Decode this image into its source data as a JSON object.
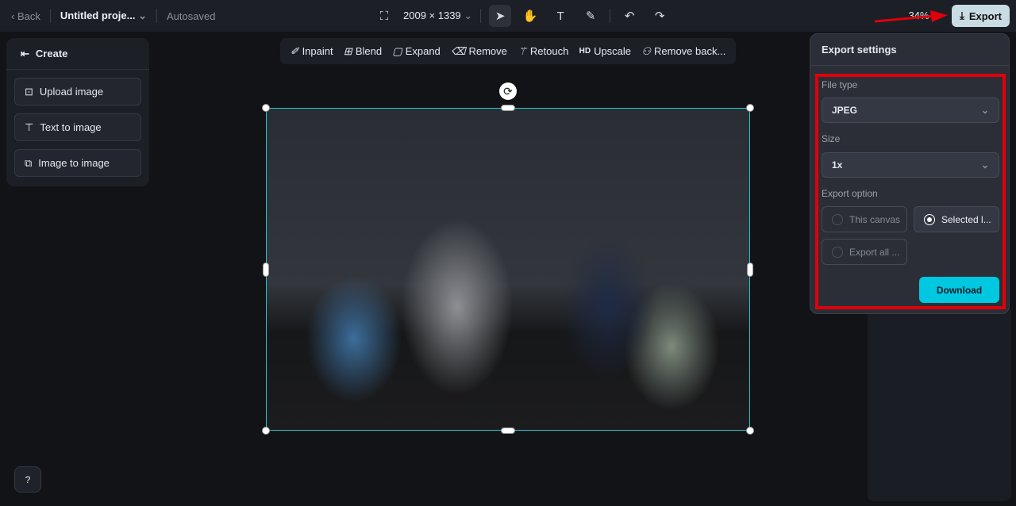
{
  "topbar": {
    "back": "Back",
    "project": "Untitled proje...",
    "status": "Autosaved",
    "dimensions": "2009 × 1339",
    "zoom": "34%",
    "export": "Export"
  },
  "left_panel": {
    "title": "Create",
    "buttons": [
      "Upload image",
      "Text to image",
      "Image to image"
    ]
  },
  "edit_tools": [
    "Inpaint",
    "Blend",
    "Expand",
    "Remove",
    "Retouch",
    "Upscale",
    "Remove back..."
  ],
  "upscale_badge": "HD",
  "export_settings": {
    "title": "Export settings",
    "file_type_label": "File type",
    "file_type": "JPEG",
    "size_label": "Size",
    "size": "1x",
    "option_label": "Export option",
    "options": [
      "This canvas",
      "Selected l...",
      "Export all ..."
    ],
    "selected_option": "Selected l...",
    "download": "Download"
  },
  "colors": {
    "accent": "#00c8e0",
    "selection": "#1fc8cf",
    "annotation": "#e0000a"
  }
}
